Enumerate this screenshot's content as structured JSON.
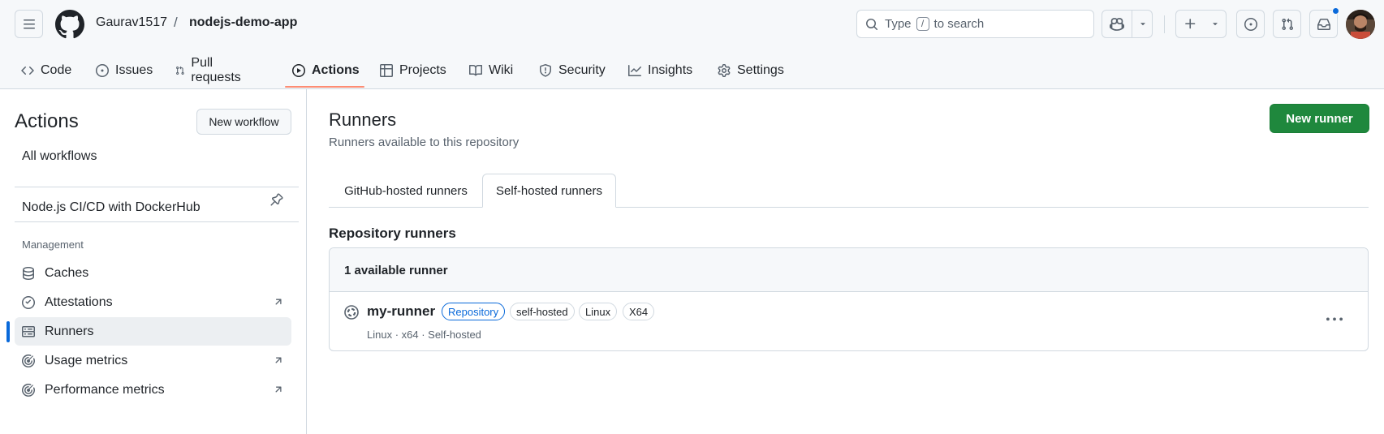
{
  "header": {
    "owner": "Gaurav1517",
    "separator": "/",
    "repo": "nodejs-demo-app",
    "search": {
      "prefix": "Type",
      "key": "/",
      "suffix": "to search"
    }
  },
  "repo_nav": [
    {
      "label": "Code",
      "icon": "code-icon"
    },
    {
      "label": "Issues",
      "icon": "issue-icon"
    },
    {
      "label": "Pull requests",
      "icon": "pull-request-icon"
    },
    {
      "label": "Actions",
      "icon": "play-icon",
      "active": true
    },
    {
      "label": "Projects",
      "icon": "table-icon"
    },
    {
      "label": "Wiki",
      "icon": "book-icon"
    },
    {
      "label": "Security",
      "icon": "shield-icon"
    },
    {
      "label": "Insights",
      "icon": "graph-icon"
    },
    {
      "label": "Settings",
      "icon": "gear-icon"
    }
  ],
  "sidebar": {
    "title": "Actions",
    "new_workflow": "New workflow",
    "all_workflows": "All workflows",
    "workflow": "Node.js CI/CD with DockerHub",
    "section": "Management",
    "items": [
      {
        "label": "Caches",
        "icon": "database-icon"
      },
      {
        "label": "Attestations",
        "icon": "verified-icon"
      },
      {
        "label": "Runners",
        "icon": "server-icon",
        "active": true
      },
      {
        "label": "Usage metrics",
        "icon": "meter-icon"
      },
      {
        "label": "Performance metrics",
        "icon": "meter-icon"
      }
    ]
  },
  "main": {
    "title": "Runners",
    "subtitle": "Runners available to this repository",
    "new_runner": "New runner",
    "tabs": [
      "GitHub-hosted runners",
      "Self-hosted runners"
    ],
    "active_tab": "Self-hosted runners",
    "section_title": "Repository runners",
    "available_count": "1 available runner",
    "runner": {
      "name": "my-runner",
      "labels": [
        "Repository",
        "self-hosted",
        "Linux",
        "X64"
      ],
      "meta": "Linux · x64 · Self-hosted"
    }
  },
  "colors": {
    "accent": "#0969da",
    "primary_button": "#1f883d",
    "tab_underline": "#fd8c73",
    "border": "#d1d9e0"
  }
}
